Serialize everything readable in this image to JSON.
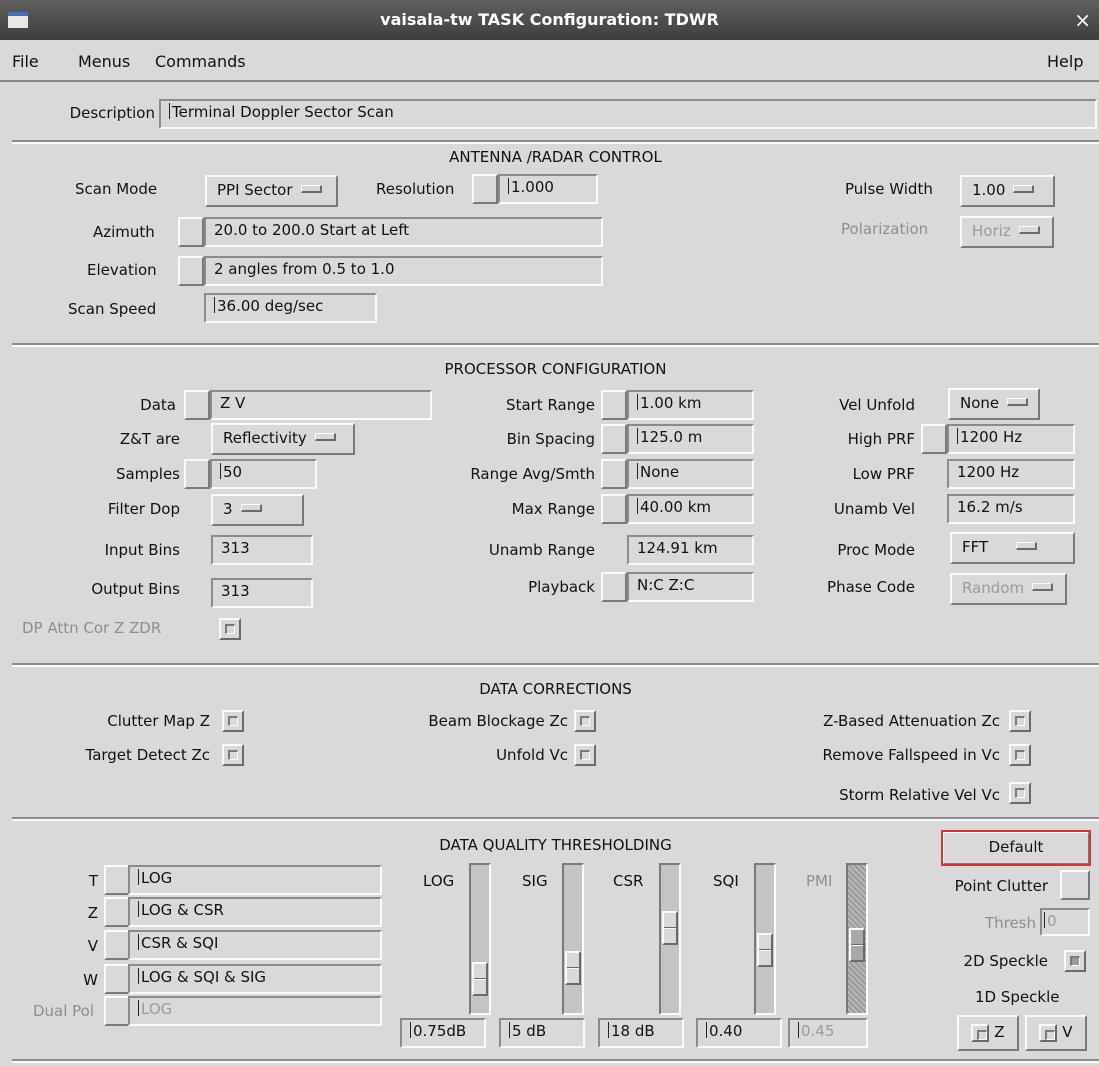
{
  "window": {
    "title": "vaisala-tw   TASK Configuration: TDWR",
    "close": "×"
  },
  "menubar": {
    "file": "File",
    "menus": "Menus",
    "commands": "Commands",
    "help": "Help"
  },
  "description": {
    "label": "Description",
    "value": "Terminal Doppler Sector Scan"
  },
  "antenna": {
    "header": "ANTENNA /RADAR CONTROL",
    "scan_mode_label": "Scan Mode",
    "scan_mode_value": "PPI Sector",
    "resolution_label": "Resolution",
    "resolution_value": "1.000",
    "pulse_width_label": "Pulse Width",
    "pulse_width_value": "1.00",
    "azimuth_label": "Azimuth",
    "azimuth_value": "20.0 to 200.0  Start at Left",
    "polarization_label": "Polarization",
    "polarization_value": "Horiz",
    "elevation_label": "Elevation",
    "elevation_value": "2 angles from 0.5 to 1.0",
    "scan_speed_label": "Scan Speed",
    "scan_speed_value": "36.00 deg/sec"
  },
  "processor": {
    "header": "PROCESSOR CONFIGURATION",
    "data_label": "Data",
    "data_value": "Z V",
    "zt_label": "Z&T are",
    "zt_value": "Reflectivity",
    "samples_label": "Samples",
    "samples_value": "50",
    "filter_dop_label": "Filter Dop",
    "filter_dop_value": "3",
    "input_bins_label": "Input Bins",
    "input_bins_value": "313",
    "output_bins_label": "Output Bins",
    "output_bins_value": "313",
    "dp_attn_label": "DP Attn Cor Z ZDR",
    "start_range_label": "Start Range",
    "start_range_value": "1.00 km",
    "bin_spacing_label": "Bin Spacing",
    "bin_spacing_value": "125.0 m",
    "range_avg_label": "Range Avg/Smth",
    "range_avg_value": "None",
    "max_range_label": "Max Range",
    "max_range_value": "40.00 km",
    "unamb_range_label": "Unamb Range",
    "unamb_range_value": "124.91 km",
    "playback_label": "Playback",
    "playback_value": "N:C Z:C",
    "vel_unfold_label": "Vel Unfold",
    "vel_unfold_value": "None",
    "high_prf_label": "High PRF",
    "high_prf_value": "1200 Hz",
    "low_prf_label": "Low PRF",
    "low_prf_value": "1200 Hz",
    "unamb_vel_label": "Unamb Vel",
    "unamb_vel_value": "16.2 m/s",
    "proc_mode_label": "Proc Mode",
    "proc_mode_value": "FFT",
    "phase_code_label": "Phase Code",
    "phase_code_value": "Random"
  },
  "corrections": {
    "header": "DATA CORRECTIONS",
    "clutter_map": "Clutter Map Z",
    "target_detect": "Target Detect Zc",
    "beam_blockage": "Beam Blockage Zc",
    "unfold_vc": "Unfold Vc",
    "z_based_atten": "Z-Based Attenuation Zc",
    "remove_fallspeed": "Remove Fallspeed in Vc",
    "storm_relative": "Storm Relative Vel Vc"
  },
  "thresholding": {
    "header": "DATA QUALITY THRESHOLDING",
    "rows": [
      {
        "label": "T",
        "value": "LOG"
      },
      {
        "label": "Z",
        "value": "LOG & CSR"
      },
      {
        "label": "V",
        "value": "CSR & SQI"
      },
      {
        "label": "W",
        "value": "LOG & SQI & SIG"
      },
      {
        "label": "Dual Pol",
        "value": "LOG"
      }
    ],
    "sliders": [
      {
        "label": "LOG",
        "value": "0.75dB",
        "level": 0.15
      },
      {
        "label": "SIG",
        "value": "5 dB",
        "level": 0.25
      },
      {
        "label": "CSR",
        "value": "18 dB",
        "level": 0.6
      },
      {
        "label": "SQI",
        "value": "0.40",
        "level": 0.4
      },
      {
        "label": "PMI",
        "value": "0.45",
        "level": 0.45
      }
    ],
    "default_button": "Default",
    "point_clutter": "Point Clutter",
    "thresh_label": "Thresh",
    "thresh_value": "0",
    "speckle_2d": "2D Speckle",
    "speckle_1d": "1D Speckle",
    "speckle_z": "Z",
    "speckle_v": "V"
  },
  "colors": {
    "default_border": "#e03030",
    "background": "#d9d9d9"
  }
}
